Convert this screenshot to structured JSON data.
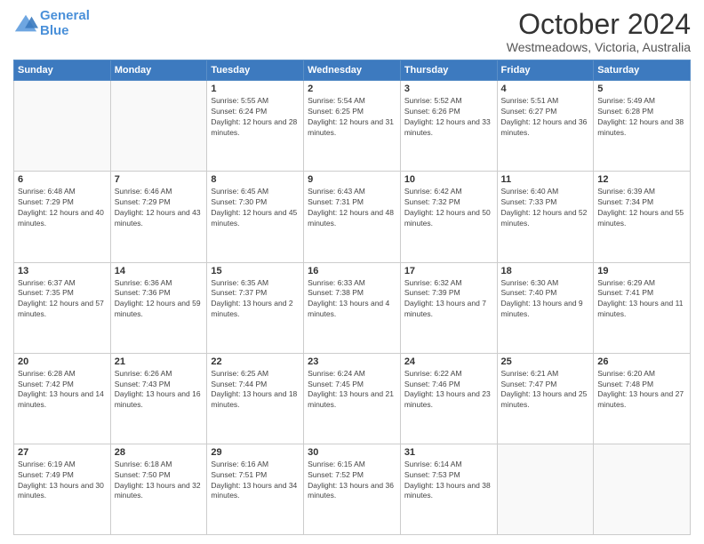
{
  "logo": {
    "line1": "General",
    "line2": "Blue"
  },
  "title": "October 2024",
  "subtitle": "Westmeadows, Victoria, Australia",
  "days_of_week": [
    "Sunday",
    "Monday",
    "Tuesday",
    "Wednesday",
    "Thursday",
    "Friday",
    "Saturday"
  ],
  "weeks": [
    [
      {
        "day": "",
        "sunrise": "",
        "sunset": "",
        "daylight": ""
      },
      {
        "day": "",
        "sunrise": "",
        "sunset": "",
        "daylight": ""
      },
      {
        "day": "1",
        "sunrise": "Sunrise: 5:55 AM",
        "sunset": "Sunset: 6:24 PM",
        "daylight": "Daylight: 12 hours and 28 minutes."
      },
      {
        "day": "2",
        "sunrise": "Sunrise: 5:54 AM",
        "sunset": "Sunset: 6:25 PM",
        "daylight": "Daylight: 12 hours and 31 minutes."
      },
      {
        "day": "3",
        "sunrise": "Sunrise: 5:52 AM",
        "sunset": "Sunset: 6:26 PM",
        "daylight": "Daylight: 12 hours and 33 minutes."
      },
      {
        "day": "4",
        "sunrise": "Sunrise: 5:51 AM",
        "sunset": "Sunset: 6:27 PM",
        "daylight": "Daylight: 12 hours and 36 minutes."
      },
      {
        "day": "5",
        "sunrise": "Sunrise: 5:49 AM",
        "sunset": "Sunset: 6:28 PM",
        "daylight": "Daylight: 12 hours and 38 minutes."
      }
    ],
    [
      {
        "day": "6",
        "sunrise": "Sunrise: 6:48 AM",
        "sunset": "Sunset: 7:29 PM",
        "daylight": "Daylight: 12 hours and 40 minutes."
      },
      {
        "day": "7",
        "sunrise": "Sunrise: 6:46 AM",
        "sunset": "Sunset: 7:29 PM",
        "daylight": "Daylight: 12 hours and 43 minutes."
      },
      {
        "day": "8",
        "sunrise": "Sunrise: 6:45 AM",
        "sunset": "Sunset: 7:30 PM",
        "daylight": "Daylight: 12 hours and 45 minutes."
      },
      {
        "day": "9",
        "sunrise": "Sunrise: 6:43 AM",
        "sunset": "Sunset: 7:31 PM",
        "daylight": "Daylight: 12 hours and 48 minutes."
      },
      {
        "day": "10",
        "sunrise": "Sunrise: 6:42 AM",
        "sunset": "Sunset: 7:32 PM",
        "daylight": "Daylight: 12 hours and 50 minutes."
      },
      {
        "day": "11",
        "sunrise": "Sunrise: 6:40 AM",
        "sunset": "Sunset: 7:33 PM",
        "daylight": "Daylight: 12 hours and 52 minutes."
      },
      {
        "day": "12",
        "sunrise": "Sunrise: 6:39 AM",
        "sunset": "Sunset: 7:34 PM",
        "daylight": "Daylight: 12 hours and 55 minutes."
      }
    ],
    [
      {
        "day": "13",
        "sunrise": "Sunrise: 6:37 AM",
        "sunset": "Sunset: 7:35 PM",
        "daylight": "Daylight: 12 hours and 57 minutes."
      },
      {
        "day": "14",
        "sunrise": "Sunrise: 6:36 AM",
        "sunset": "Sunset: 7:36 PM",
        "daylight": "Daylight: 12 hours and 59 minutes."
      },
      {
        "day": "15",
        "sunrise": "Sunrise: 6:35 AM",
        "sunset": "Sunset: 7:37 PM",
        "daylight": "Daylight: 13 hours and 2 minutes."
      },
      {
        "day": "16",
        "sunrise": "Sunrise: 6:33 AM",
        "sunset": "Sunset: 7:38 PM",
        "daylight": "Daylight: 13 hours and 4 minutes."
      },
      {
        "day": "17",
        "sunrise": "Sunrise: 6:32 AM",
        "sunset": "Sunset: 7:39 PM",
        "daylight": "Daylight: 13 hours and 7 minutes."
      },
      {
        "day": "18",
        "sunrise": "Sunrise: 6:30 AM",
        "sunset": "Sunset: 7:40 PM",
        "daylight": "Daylight: 13 hours and 9 minutes."
      },
      {
        "day": "19",
        "sunrise": "Sunrise: 6:29 AM",
        "sunset": "Sunset: 7:41 PM",
        "daylight": "Daylight: 13 hours and 11 minutes."
      }
    ],
    [
      {
        "day": "20",
        "sunrise": "Sunrise: 6:28 AM",
        "sunset": "Sunset: 7:42 PM",
        "daylight": "Daylight: 13 hours and 14 minutes."
      },
      {
        "day": "21",
        "sunrise": "Sunrise: 6:26 AM",
        "sunset": "Sunset: 7:43 PM",
        "daylight": "Daylight: 13 hours and 16 minutes."
      },
      {
        "day": "22",
        "sunrise": "Sunrise: 6:25 AM",
        "sunset": "Sunset: 7:44 PM",
        "daylight": "Daylight: 13 hours and 18 minutes."
      },
      {
        "day": "23",
        "sunrise": "Sunrise: 6:24 AM",
        "sunset": "Sunset: 7:45 PM",
        "daylight": "Daylight: 13 hours and 21 minutes."
      },
      {
        "day": "24",
        "sunrise": "Sunrise: 6:22 AM",
        "sunset": "Sunset: 7:46 PM",
        "daylight": "Daylight: 13 hours and 23 minutes."
      },
      {
        "day": "25",
        "sunrise": "Sunrise: 6:21 AM",
        "sunset": "Sunset: 7:47 PM",
        "daylight": "Daylight: 13 hours and 25 minutes."
      },
      {
        "day": "26",
        "sunrise": "Sunrise: 6:20 AM",
        "sunset": "Sunset: 7:48 PM",
        "daylight": "Daylight: 13 hours and 27 minutes."
      }
    ],
    [
      {
        "day": "27",
        "sunrise": "Sunrise: 6:19 AM",
        "sunset": "Sunset: 7:49 PM",
        "daylight": "Daylight: 13 hours and 30 minutes."
      },
      {
        "day": "28",
        "sunrise": "Sunrise: 6:18 AM",
        "sunset": "Sunset: 7:50 PM",
        "daylight": "Daylight: 13 hours and 32 minutes."
      },
      {
        "day": "29",
        "sunrise": "Sunrise: 6:16 AM",
        "sunset": "Sunset: 7:51 PM",
        "daylight": "Daylight: 13 hours and 34 minutes."
      },
      {
        "day": "30",
        "sunrise": "Sunrise: 6:15 AM",
        "sunset": "Sunset: 7:52 PM",
        "daylight": "Daylight: 13 hours and 36 minutes."
      },
      {
        "day": "31",
        "sunrise": "Sunrise: 6:14 AM",
        "sunset": "Sunset: 7:53 PM",
        "daylight": "Daylight: 13 hours and 38 minutes."
      },
      {
        "day": "",
        "sunrise": "",
        "sunset": "",
        "daylight": ""
      },
      {
        "day": "",
        "sunrise": "",
        "sunset": "",
        "daylight": ""
      }
    ]
  ]
}
